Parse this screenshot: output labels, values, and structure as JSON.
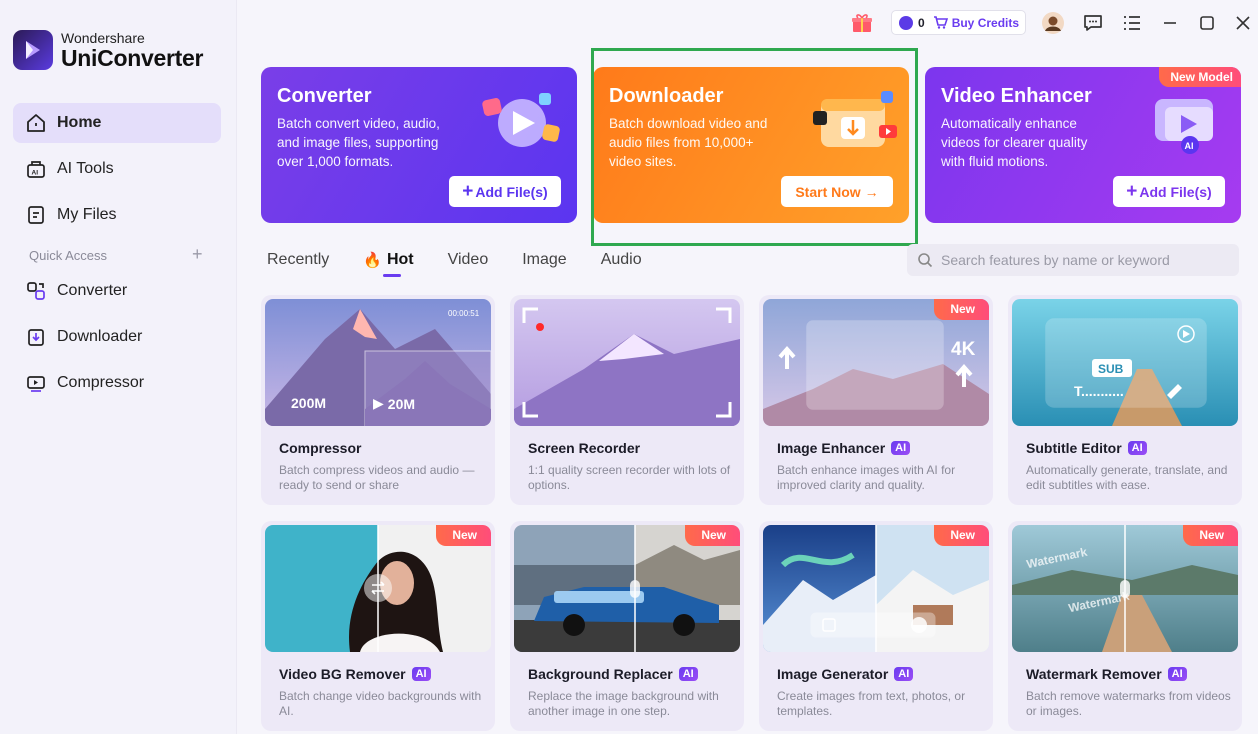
{
  "brand": {
    "line1": "Wondershare",
    "line2": "UniConverter"
  },
  "sidebar": {
    "items": [
      {
        "label": "Home",
        "icon": "home-icon",
        "active": true
      },
      {
        "label": "AI Tools",
        "icon": "ai-tools-icon"
      },
      {
        "label": "My Files",
        "icon": "files-icon"
      }
    ],
    "quick_access_label": "Quick Access",
    "quick_items": [
      {
        "label": "Converter",
        "icon": "converter-icon"
      },
      {
        "label": "Downloader",
        "icon": "downloader-icon"
      },
      {
        "label": "Compressor",
        "icon": "compressor-icon"
      }
    ]
  },
  "topbar": {
    "credit_count": "0",
    "buy_credits": "Buy Credits"
  },
  "hero": [
    {
      "title": "Converter",
      "desc": [
        "Batch convert video, audio,",
        "and image files, supporting",
        "over 1,000 formats."
      ],
      "button": "Add File(s)"
    },
    {
      "title": "Downloader",
      "desc": [
        "Batch download video and",
        "audio files from 10,000+",
        "video sites."
      ],
      "button": "Start Now"
    },
    {
      "title": "Video Enhancer",
      "desc": [
        "Automatically enhance",
        "videos for clearer quality",
        "with fluid motions."
      ],
      "button": "Add File(s)",
      "badge": "New Model"
    }
  ],
  "tabs": [
    "Recently",
    "Hot",
    "Video",
    "Image",
    "Audio"
  ],
  "active_tab": "Hot",
  "search": {
    "placeholder": "Search features by name or keyword"
  },
  "cards": [
    {
      "title": "Compressor",
      "ai": false,
      "new": false,
      "desc": "Batch compress videos and audio — ready to send or share",
      "thumb": {
        "left_size": "200M",
        "right_size": "20M",
        "time": "00:00:51"
      }
    },
    {
      "title": "Screen Recorder",
      "ai": false,
      "new": false,
      "desc": "1:1 quality screen recorder with lots of options."
    },
    {
      "title": "Image Enhancer",
      "ai": true,
      "new": true,
      "desc": "Batch enhance images with AI for improved clarity and quality.",
      "thumb": {
        "res": "4K"
      }
    },
    {
      "title": "Subtitle Editor",
      "ai": true,
      "new": false,
      "desc": "Automatically generate, translate, and edit subtitles with ease.",
      "thumb": {
        "sub": "SUB",
        "text": "T..........."
      }
    },
    {
      "title": "Video BG Remover",
      "ai": true,
      "new": true,
      "desc": "Batch change video backgrounds with AI."
    },
    {
      "title": "Background Replacer",
      "ai": true,
      "new": true,
      "desc": "Replace the image background with another image in one step."
    },
    {
      "title": "Image Generator",
      "ai": true,
      "new": true,
      "desc": "Create images from text, photos, or templates."
    },
    {
      "title": "Watermark Remover",
      "ai": true,
      "new": true,
      "desc": "Batch remove watermarks from videos or images.",
      "thumb": {
        "watermark": "Watermark"
      }
    }
  ],
  "labels": {
    "ai": "AI",
    "new": "New"
  },
  "colors": {
    "accent": "#6a3cf0",
    "highlight": "#2fa84f",
    "downloader": "#ff8a1e"
  }
}
